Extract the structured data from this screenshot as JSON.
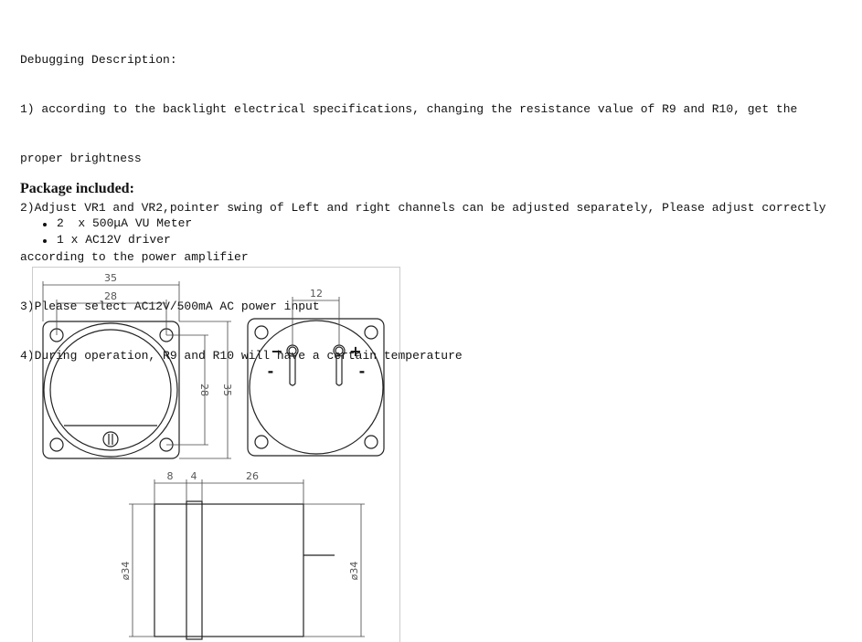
{
  "debugging": {
    "heading": "Debugging Description:",
    "lines": [
      "1) according to the backlight electrical specifications, changing the resistance value of R9 and R10, get the",
      "proper brightness",
      "2)Adjust VR1 and VR2,pointer swing of Left and right channels can be adjusted separately, Please adjust correctly",
      "according to the power amplifier",
      "3)Please select AC12V/500mA AC power input",
      "4)During operation, R9 and R10 will have a certain temperature"
    ]
  },
  "package": {
    "title": "Package included:",
    "items": [
      "2  x 500μA VU Meter",
      "1 x AC12V driver"
    ]
  },
  "diagram": {
    "front": {
      "width_outer": "35",
      "hole_spacing_h": "28",
      "hole_spacing_v": "28",
      "height_outer": "35"
    },
    "back": {
      "terminal_spacing": "12",
      "sign_neg": "−",
      "sign_pos": "+",
      "sign_minus_left": "-",
      "sign_minus_right": "-"
    },
    "side": {
      "front_depth": "8",
      "band_depth": "4",
      "body_depth": "26",
      "diameter_left": "ø34",
      "diameter_right": "ø34"
    }
  }
}
